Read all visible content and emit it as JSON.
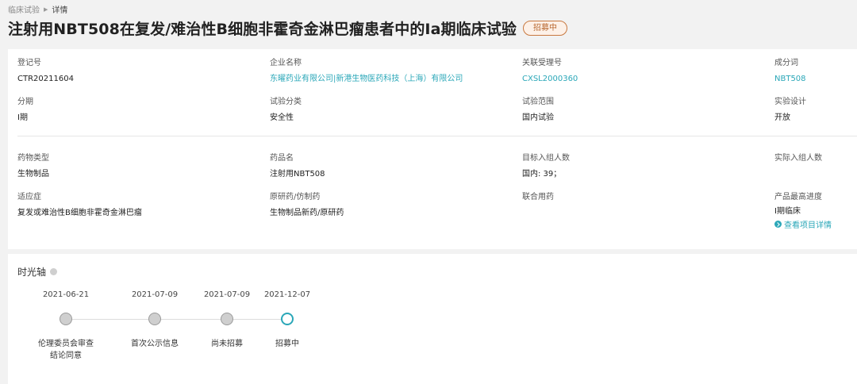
{
  "breadcrumb": {
    "parent": "临床试验",
    "current": "详情"
  },
  "title": "注射用NBT508在复发/难治性B细胞非霍奇金淋巴瘤患者中的Ⅰa期临床试验",
  "status_badge": "招募中",
  "fields": {
    "reg_no": {
      "label": "登记号",
      "value": "CTR20211604"
    },
    "company": {
      "label": "企业名称",
      "value": "东曜药业有限公司|新港生物医药科技（上海）有限公司"
    },
    "accept_no": {
      "label": "关联受理号",
      "value": "CXSL2000360"
    },
    "ingredient": {
      "label": "成分词",
      "value": "NBT508"
    },
    "phase": {
      "label": "分期",
      "value": "I期"
    },
    "trial_class": {
      "label": "试验分类",
      "value": "安全性"
    },
    "trial_scope": {
      "label": "试验范围",
      "value": "国内试验"
    },
    "design": {
      "label": "实验设计",
      "value": "开放"
    },
    "drug_type": {
      "label": "药物类型",
      "value": "生物制品"
    },
    "drug_name": {
      "label": "药品名",
      "value": "注射用NBT508"
    },
    "target_enroll": {
      "label": "目标入组人数",
      "value": "国内: 39；"
    },
    "actual_enroll": {
      "label": "实际入组人数",
      "value": ""
    },
    "indication": {
      "label": "适应症",
      "value": "复发或难治性B细胞非霍奇金淋巴瘤"
    },
    "original_generic": {
      "label": "原研药/仿制药",
      "value": "生物制品新药/原研药"
    },
    "combo": {
      "label": "联合用药",
      "value": ""
    },
    "max_stage": {
      "label": "产品最高进度",
      "value": "I期临床",
      "link": "查看项目详情"
    }
  },
  "timeline": {
    "title": "时光轴",
    "events": [
      {
        "date": "2021-06-21",
        "label": "伦理委员会审查\n结论同意",
        "state": "done"
      },
      {
        "date": "2021-07-09",
        "label": "首次公示信息",
        "state": "done"
      },
      {
        "date": "2021-07-09",
        "label": "尚未招募",
        "state": "done"
      },
      {
        "date": "2021-12-07",
        "label": "招募中",
        "state": "current"
      }
    ]
  },
  "colors": {
    "accent": "#2aa7b8",
    "badge": "#c8783f",
    "background": "#f2f2f2"
  }
}
